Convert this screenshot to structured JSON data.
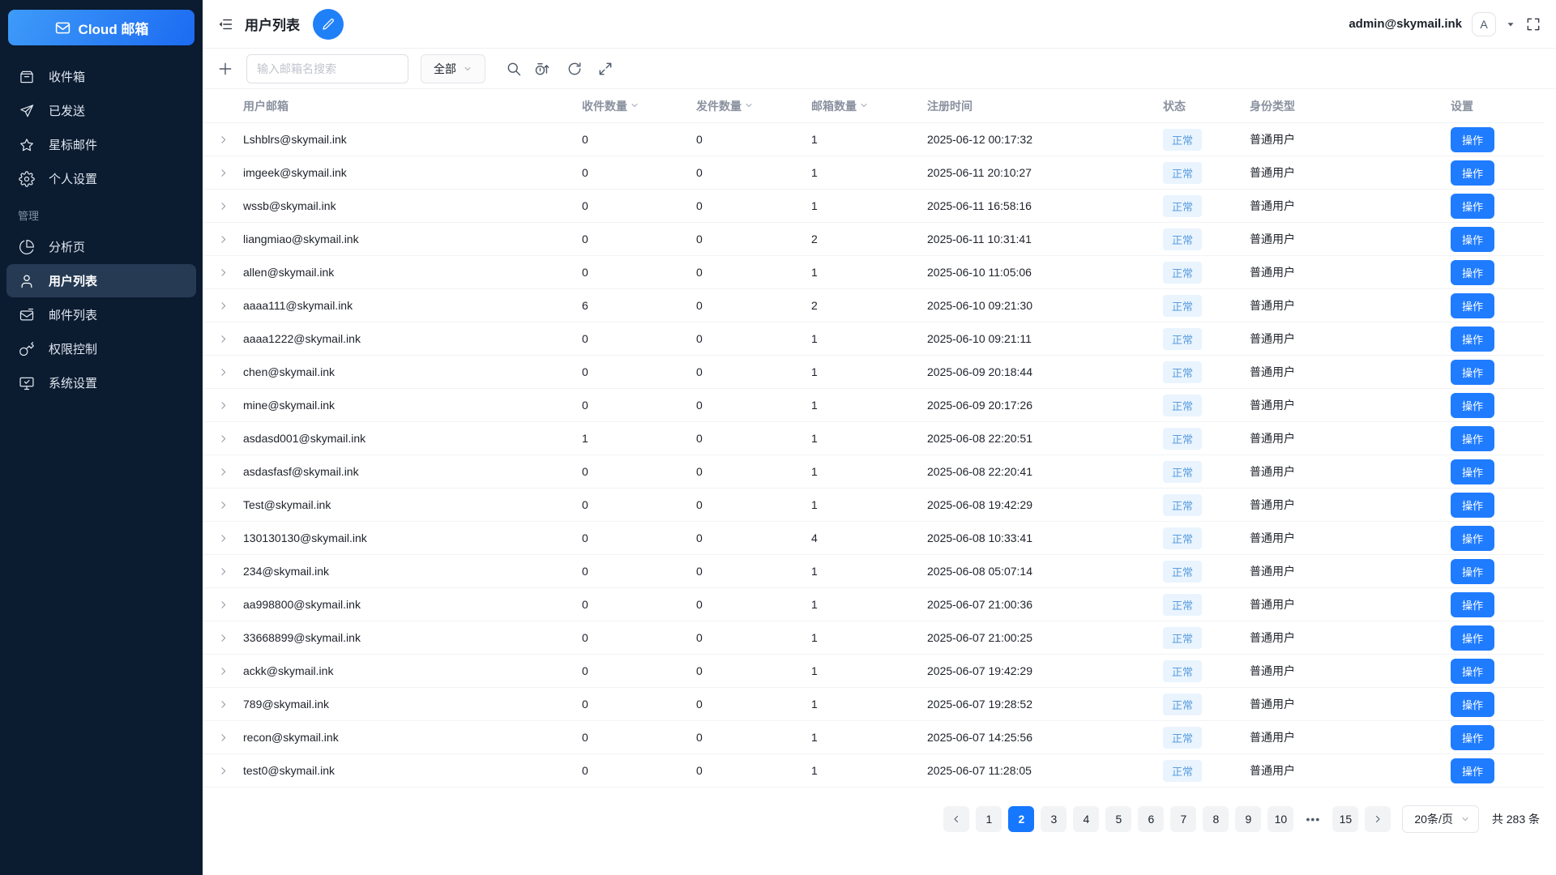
{
  "colors": {
    "accent": "#1677ff",
    "action_button": "#1f7cff",
    "sidebar_bg": "#0b1b30",
    "sidebar_active_bg": "#263a54",
    "logo_gradient_start": "#3e9bf8",
    "logo_gradient_end": "#1c6bf2",
    "badge_bg": "#e9f4fe",
    "badge_text": "#5b9ddd"
  },
  "sidebar": {
    "logo_label": "Cloud 邮箱",
    "items": [
      {
        "label": "收件箱",
        "icon": "inbox-icon"
      },
      {
        "label": "已发送",
        "icon": "send-icon"
      },
      {
        "label": "星标邮件",
        "icon": "star-icon"
      },
      {
        "label": "个人设置",
        "icon": "gear-icon"
      }
    ],
    "section_label": "管理",
    "admin_items": [
      {
        "label": "分析页",
        "icon": "pie-chart-icon",
        "active": false
      },
      {
        "label": "用户列表",
        "icon": "user-icon",
        "active": true
      },
      {
        "label": "邮件列表",
        "icon": "mail-list-icon",
        "active": false
      },
      {
        "label": "权限控制",
        "icon": "key-icon",
        "active": false
      },
      {
        "label": "系统设置",
        "icon": "monitor-check-icon",
        "active": false
      }
    ]
  },
  "header": {
    "title": "用户列表",
    "account": "admin@skymail.ink",
    "avatar_letter": "A"
  },
  "toolbar": {
    "search_placeholder": "输入邮箱名搜索",
    "filter_value": "全部"
  },
  "table": {
    "columns": [
      "用户邮箱",
      "收件数量",
      "发件数量",
      "邮箱数量",
      "注册时间",
      "状态",
      "身份类型",
      "设置"
    ],
    "action_label": "操作",
    "rows": [
      {
        "email": "Lshblrs@skymail.ink",
        "inbox": "0",
        "sent": "0",
        "mailboxes": "1",
        "registered": "2025-06-12 00:17:32",
        "status": "正常",
        "role": "普通用户"
      },
      {
        "email": "imgeek@skymail.ink",
        "inbox": "0",
        "sent": "0",
        "mailboxes": "1",
        "registered": "2025-06-11 20:10:27",
        "status": "正常",
        "role": "普通用户"
      },
      {
        "email": "wssb@skymail.ink",
        "inbox": "0",
        "sent": "0",
        "mailboxes": "1",
        "registered": "2025-06-11 16:58:16",
        "status": "正常",
        "role": "普通用户"
      },
      {
        "email": "liangmiao@skymail.ink",
        "inbox": "0",
        "sent": "0",
        "mailboxes": "2",
        "registered": "2025-06-11 10:31:41",
        "status": "正常",
        "role": "普通用户"
      },
      {
        "email": "allen@skymail.ink",
        "inbox": "0",
        "sent": "0",
        "mailboxes": "1",
        "registered": "2025-06-10 11:05:06",
        "status": "正常",
        "role": "普通用户"
      },
      {
        "email": "aaaa111@skymail.ink",
        "inbox": "6",
        "sent": "0",
        "mailboxes": "2",
        "registered": "2025-06-10 09:21:30",
        "status": "正常",
        "role": "普通用户"
      },
      {
        "email": "aaaa1222@skymail.ink",
        "inbox": "0",
        "sent": "0",
        "mailboxes": "1",
        "registered": "2025-06-10 09:21:11",
        "status": "正常",
        "role": "普通用户"
      },
      {
        "email": "chen@skymail.ink",
        "inbox": "0",
        "sent": "0",
        "mailboxes": "1",
        "registered": "2025-06-09 20:18:44",
        "status": "正常",
        "role": "普通用户"
      },
      {
        "email": "mine@skymail.ink",
        "inbox": "0",
        "sent": "0",
        "mailboxes": "1",
        "registered": "2025-06-09 20:17:26",
        "status": "正常",
        "role": "普通用户"
      },
      {
        "email": "asdasd001@skymail.ink",
        "inbox": "1",
        "sent": "0",
        "mailboxes": "1",
        "registered": "2025-06-08 22:20:51",
        "status": "正常",
        "role": "普通用户"
      },
      {
        "email": "asdasfasf@skymail.ink",
        "inbox": "0",
        "sent": "0",
        "mailboxes": "1",
        "registered": "2025-06-08 22:20:41",
        "status": "正常",
        "role": "普通用户"
      },
      {
        "email": "Test@skymail.ink",
        "inbox": "0",
        "sent": "0",
        "mailboxes": "1",
        "registered": "2025-06-08 19:42:29",
        "status": "正常",
        "role": "普通用户"
      },
      {
        "email": "130130130@skymail.ink",
        "inbox": "0",
        "sent": "0",
        "mailboxes": "4",
        "registered": "2025-06-08 10:33:41",
        "status": "正常",
        "role": "普通用户"
      },
      {
        "email": "234@skymail.ink",
        "inbox": "0",
        "sent": "0",
        "mailboxes": "1",
        "registered": "2025-06-08 05:07:14",
        "status": "正常",
        "role": "普通用户"
      },
      {
        "email": "aa998800@skymail.ink",
        "inbox": "0",
        "sent": "0",
        "mailboxes": "1",
        "registered": "2025-06-07 21:00:36",
        "status": "正常",
        "role": "普通用户"
      },
      {
        "email": "33668899@skymail.ink",
        "inbox": "0",
        "sent": "0",
        "mailboxes": "1",
        "registered": "2025-06-07 21:00:25",
        "status": "正常",
        "role": "普通用户"
      },
      {
        "email": "ackk@skymail.ink",
        "inbox": "0",
        "sent": "0",
        "mailboxes": "1",
        "registered": "2025-06-07 19:42:29",
        "status": "正常",
        "role": "普通用户"
      },
      {
        "email": "789@skymail.ink",
        "inbox": "0",
        "sent": "0",
        "mailboxes": "1",
        "registered": "2025-06-07 19:28:52",
        "status": "正常",
        "role": "普通用户"
      },
      {
        "email": "recon@skymail.ink",
        "inbox": "0",
        "sent": "0",
        "mailboxes": "1",
        "registered": "2025-06-07 14:25:56",
        "status": "正常",
        "role": "普通用户"
      },
      {
        "email": "test0@skymail.ink",
        "inbox": "0",
        "sent": "0",
        "mailboxes": "1",
        "registered": "2025-06-07 11:28:05",
        "status": "正常",
        "role": "普通用户"
      }
    ]
  },
  "pagination": {
    "pages": [
      "1",
      "2",
      "3",
      "4",
      "5",
      "6",
      "7",
      "8",
      "9",
      "10",
      "•••",
      "15"
    ],
    "active": "2",
    "page_size": "20条/页",
    "total": "共 283 条"
  }
}
